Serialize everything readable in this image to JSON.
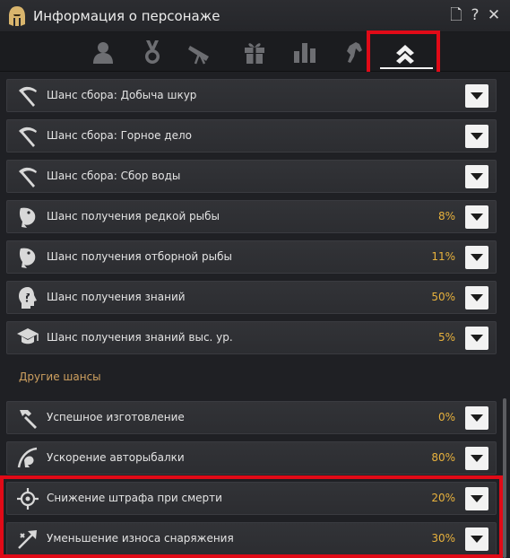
{
  "window": {
    "title": "Информация о персонаже",
    "controls": {
      "document": "🗋",
      "help": "?",
      "close": "✕"
    }
  },
  "tabs": [
    {
      "icon": "person-silhouette-icon"
    },
    {
      "icon": "medal-icon"
    },
    {
      "icon": "telescope-icon"
    },
    {
      "icon": "gift-icon"
    },
    {
      "icon": "bar-chart-icon"
    },
    {
      "icon": "horse-icon"
    },
    {
      "icon": "double-chevron-up-icon",
      "active": true
    }
  ],
  "accent_colors": {
    "value": "#e8b23d",
    "highlight": "#e10a17",
    "section": "#cfa160"
  },
  "rows_top": [
    {
      "icon": "pickaxe-icon",
      "label": "Шанс сбора: Добыча шкур",
      "value": ""
    },
    {
      "icon": "pickaxe-icon",
      "label": "Шанс сбора: Горное дело",
      "value": ""
    },
    {
      "icon": "pickaxe-icon",
      "label": "Шанс сбора: Сбор воды",
      "value": ""
    },
    {
      "icon": "fish-icon",
      "label": "Шанс получения редкой рыбы",
      "value": "8%"
    },
    {
      "icon": "fish-icon",
      "label": "Шанс получения отборной рыбы",
      "value": "11%"
    },
    {
      "icon": "knowledge-head-icon",
      "label": "Шанс получения знаний",
      "value": "50%"
    },
    {
      "icon": "graduation-cap-icon",
      "label": "Шанс получения знаний выс. ур.",
      "value": "5%"
    }
  ],
  "section": {
    "title": "Другие шансы"
  },
  "rows_bottom": [
    {
      "icon": "hammer-icon",
      "label": "Успешное изготовление",
      "value": "0%"
    },
    {
      "icon": "fishing-rod-icon",
      "label": "Ускорение авторыбалки",
      "value": "80%"
    },
    {
      "icon": "death-penalty-icon",
      "label": "Снижение штрафа при смерти",
      "value": "20%"
    },
    {
      "icon": "repair-arrow-icon",
      "label": "Уменьшение износа снаряжения",
      "value": "30%"
    }
  ]
}
